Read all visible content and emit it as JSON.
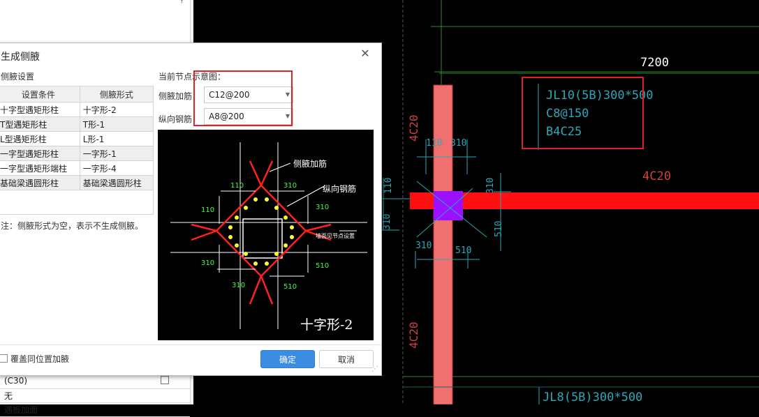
{
  "left_panel": {
    "bottom_rows": [
      {
        "value": "(C30)"
      },
      {
        "value": "无"
      },
      {
        "value": "遇板加面"
      }
    ]
  },
  "dialog": {
    "title": "生成侧腋",
    "close_glyph": "✕",
    "group_label": "侧腋设置",
    "table": {
      "headers": [
        "设置条件",
        "侧腋形式"
      ],
      "rows": [
        {
          "condition": "十字型遇矩形柱",
          "form": "十字形-2"
        },
        {
          "condition": "T型遇矩形柱",
          "form": "T形-1"
        },
        {
          "condition": "L型遇矩形柱",
          "form": "L形-1"
        },
        {
          "condition": "一字型遇矩形柱",
          "form": "一字形-1"
        },
        {
          "condition": "一字型遇矩形端柱",
          "form": "一字形-4"
        },
        {
          "condition": "基础梁遇圆形柱",
          "form": "基础梁遇圆形柱"
        }
      ]
    },
    "note": "注：侧腋形式为空，表示不生成侧腋。",
    "diagram_title": "当前节点示意图：",
    "fields": {
      "haunch_rebar_label": "侧腋加筋",
      "haunch_rebar_value": "C12@200",
      "long_rebar_label": "纵向钢筋",
      "long_rebar_value": "A8@200"
    },
    "preview": {
      "label_haunch": "侧腋加筋",
      "label_long": "纵向钢筋",
      "dims": [
        "110",
        "310",
        "110",
        "310",
        "310",
        "510",
        "310",
        "510"
      ],
      "side_note": "墙面见节点设置",
      "caption": "十字形-2"
    },
    "overwrite_label": "覆盖同位置加腋",
    "ok_label": "确定",
    "cancel_label": "取消"
  },
  "cad": {
    "span_label": "7200",
    "beam_text": [
      "JL10(5B)300*500",
      "C8@150",
      "B4C25"
    ],
    "rebar_top": "4C20",
    "rebar_left_top": "4C20",
    "rebar_left_bottom": "4C20",
    "dims": [
      "110",
      "310",
      "110",
      "310",
      "310",
      "310",
      "510",
      "510",
      "310",
      "510"
    ],
    "beam_text_bottom": "JL8(5B)300*500"
  },
  "colors": {
    "highlight_box": "#e0202a",
    "beam_red": "#ff1010",
    "column_pink": "#f07070",
    "node_purple": "#9b10ff",
    "cad_cyan": "#2aa8b8",
    "cad_dim_red": "#d04040",
    "ok_blue": "#3b8de3"
  }
}
